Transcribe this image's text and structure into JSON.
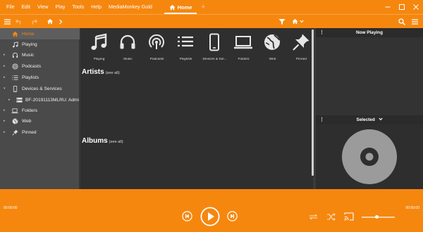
{
  "menu": {
    "items": [
      "File",
      "Edit",
      "View",
      "Play",
      "Tools",
      "Help",
      "MediaMonkey Gold"
    ],
    "home_tab": "Home",
    "new_tab_symbol": "+"
  },
  "sidebar": {
    "items": [
      {
        "label": "Home",
        "icon": "home-icon",
        "caret": ""
      },
      {
        "label": "Playing",
        "icon": "music-note-icon",
        "caret": ""
      },
      {
        "label": "Music",
        "icon": "headphones-icon",
        "caret": "▸"
      },
      {
        "label": "Podcasts",
        "icon": "podcast-icon",
        "caret": "▸"
      },
      {
        "label": "Playlists",
        "icon": "playlist-icon",
        "caret": "▸"
      },
      {
        "label": "Devices & Services",
        "icon": "phone-icon",
        "caret": "▾"
      },
      {
        "label": "BF-20191113MLRU: Admi",
        "icon": "server-icon",
        "caret": "▸"
      },
      {
        "label": "Folders",
        "icon": "laptop-icon",
        "caret": "▸"
      },
      {
        "label": "Web",
        "icon": "globe-icon",
        "caret": "▸"
      },
      {
        "label": "Pinned",
        "icon": "pin-icon",
        "caret": "▸"
      }
    ]
  },
  "main": {
    "tiles": [
      {
        "label": "Playing",
        "icon": "music-note-icon"
      },
      {
        "label": "Music",
        "icon": "headphones-icon"
      },
      {
        "label": "Podcasts",
        "icon": "podcast-icon"
      },
      {
        "label": "Playlists",
        "icon": "playlist-icon"
      },
      {
        "label": "Devices & Ser...",
        "icon": "phone-icon"
      },
      {
        "label": "Folders",
        "icon": "laptop-icon"
      },
      {
        "label": "Web",
        "icon": "globe-icon"
      },
      {
        "label": "Pinned",
        "icon": "pin-icon"
      }
    ],
    "artists": {
      "title": "Artists",
      "see_all": "(see all)"
    },
    "albums": {
      "title": "Albums",
      "see_all": "(see all)"
    }
  },
  "right_panel": {
    "now_playing": "Now Playing",
    "selected": "Selected"
  },
  "player": {
    "elapsed": "00:00:00",
    "total": "00:00:00",
    "volume": 0.45
  },
  "colors": {
    "accent": "#f5870f",
    "sidebar_bg": "#4a4a4a",
    "main_bg": "#2f2f2f",
    "panel_bg": "#3c3c3c"
  }
}
